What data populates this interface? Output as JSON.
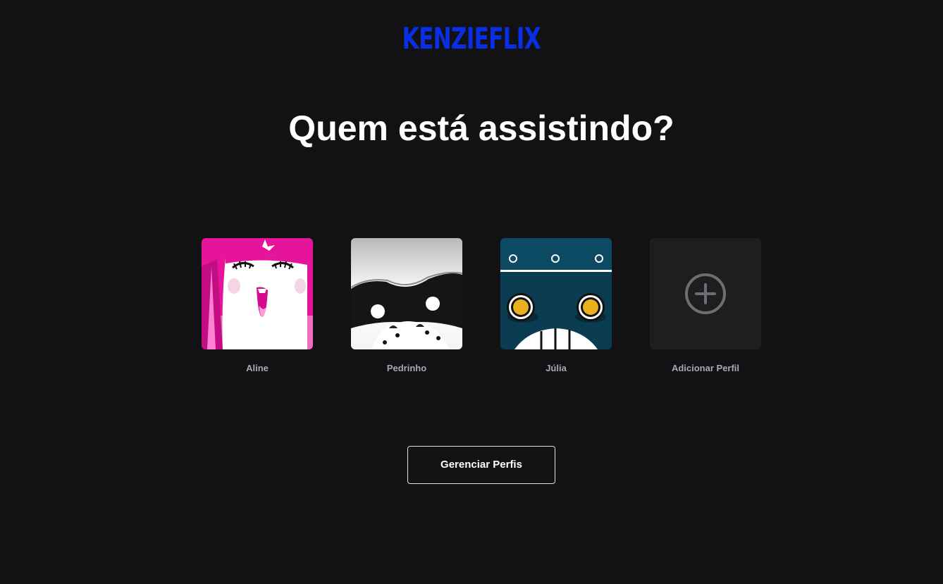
{
  "brand": {
    "logo_text": "KENZIEFLIX",
    "color": "#0a2ee6"
  },
  "heading": "Quem está assistindo?",
  "profiles": [
    {
      "name": "Aline",
      "avatar_icon": "pink-character-avatar",
      "accent": "#e6139b"
    },
    {
      "name": "Pedrinho",
      "avatar_icon": "panda-character-avatar",
      "accent": "#1a1a1a"
    },
    {
      "name": "Júlia",
      "avatar_icon": "robot-character-avatar",
      "accent": "#0b3d52"
    }
  ],
  "add_profile": {
    "label": "Adicionar Perfil",
    "icon": "plus-circle-icon"
  },
  "manage_button": {
    "label": "Gerenciar Perfis"
  },
  "colors": {
    "background": "#121214",
    "text_primary": "#ffffff",
    "text_secondary": "#a8a8b3"
  }
}
